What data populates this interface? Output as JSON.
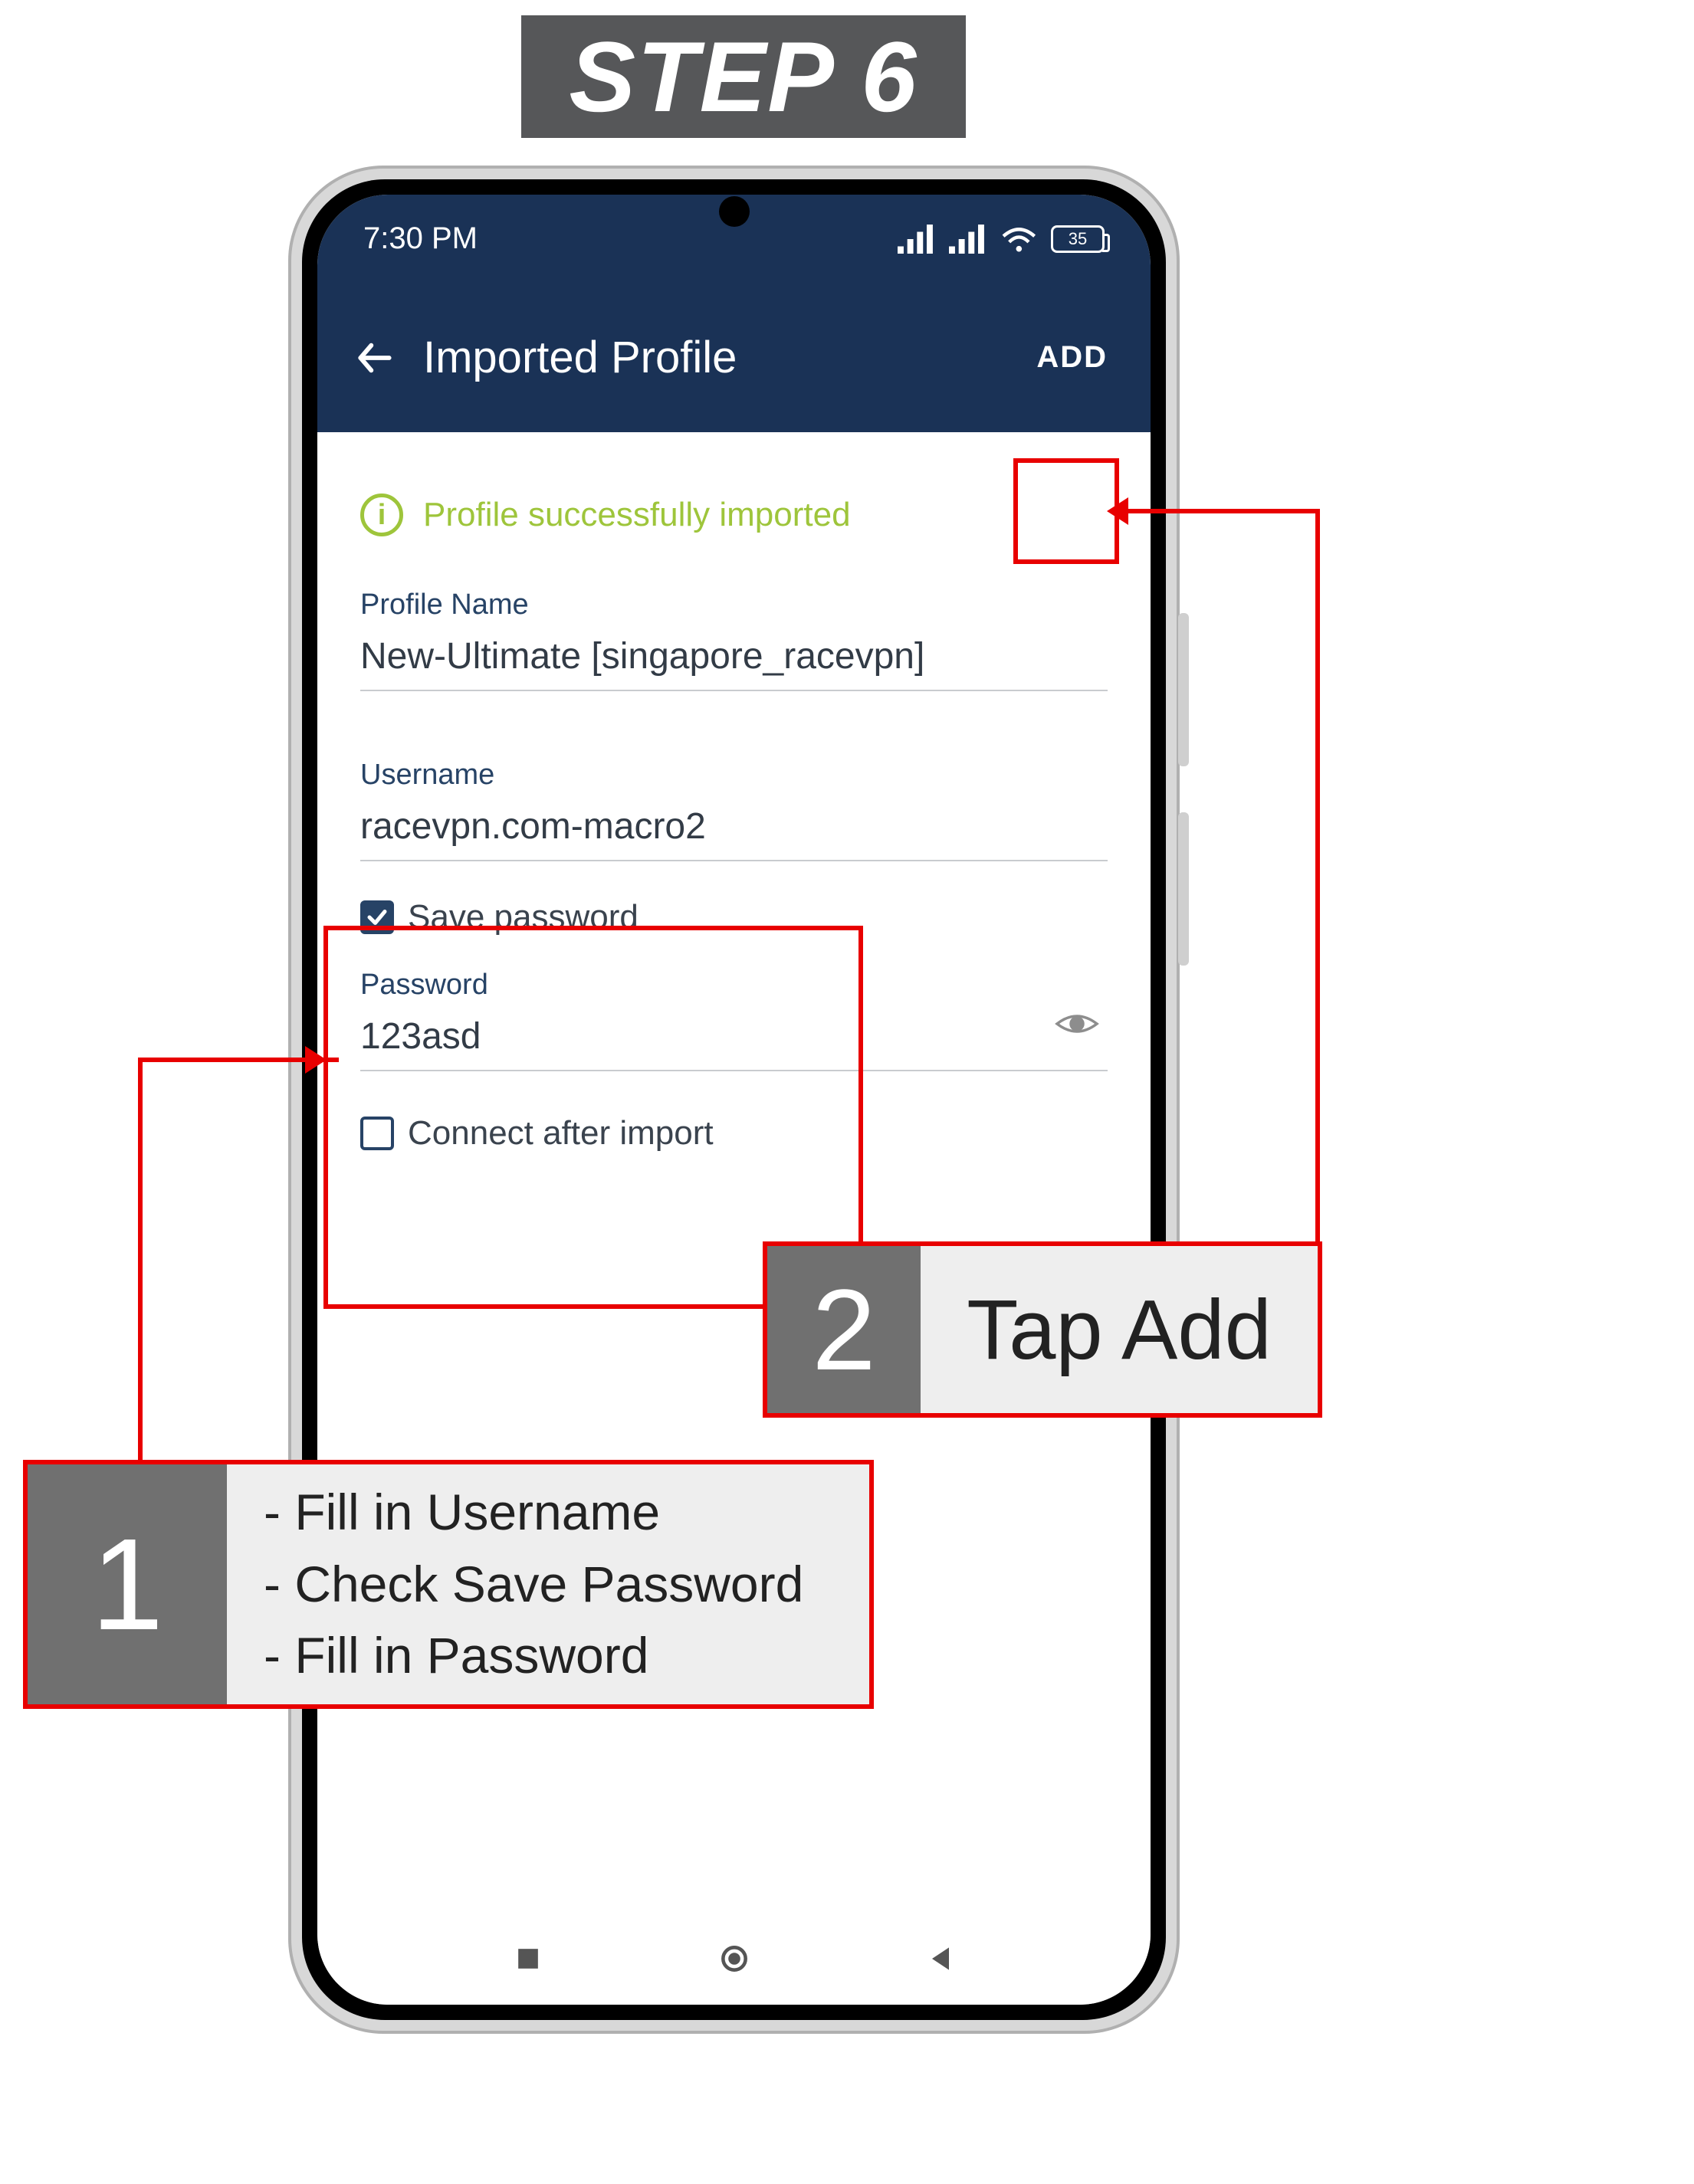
{
  "step_label": "STEP 6",
  "statusbar": {
    "time": "7:30 PM",
    "battery": "35"
  },
  "appbar": {
    "title": "Imported Profile",
    "add_label": "ADD"
  },
  "success_msg": "Profile successfully imported",
  "fields": {
    "profile_name": {
      "label": "Profile Name",
      "value": "New-Ultimate [singapore_racevpn]"
    },
    "username": {
      "label": "Username",
      "value": "racevpn.com-macro2"
    },
    "save_password": {
      "label": "Save password"
    },
    "password": {
      "label": "Password",
      "value": "123asd"
    },
    "connect_after": {
      "label": "Connect after import"
    }
  },
  "callouts": {
    "c1": {
      "num": "1",
      "line1": "- Fill in Username",
      "line2": "- Check Save Password",
      "line3": "- Fill in Password"
    },
    "c2": {
      "num": "2",
      "text": "Tap Add"
    }
  }
}
